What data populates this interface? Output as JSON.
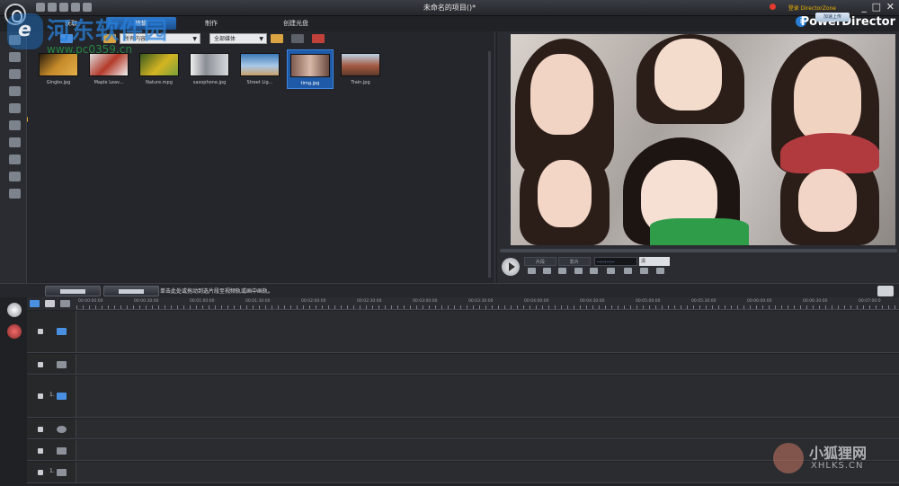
{
  "window": {
    "title": "未命名的项目()*",
    "login_text": "登录 DirectorZone",
    "upload_label": "加速上传",
    "brand": "PowerDirector",
    "controls": [
      "_",
      "□",
      "✕"
    ]
  },
  "watermark": {
    "site_title": "河东软件园",
    "site_url": "www.pc0359.cn",
    "corner_title": "小狐狸网",
    "corner_sub": "XHLKS.CN"
  },
  "mode_tabs": [
    {
      "label": "获取",
      "active": false
    },
    {
      "label": "编辑",
      "active": true
    },
    {
      "label": "制作",
      "active": false
    },
    {
      "label": "创建光盘",
      "active": false
    }
  ],
  "library": {
    "filter_dropdown": "所有内容",
    "scope_dropdown": "全部媒体",
    "items": [
      {
        "name": "Gingko.jpg",
        "color": "#c58a2a"
      },
      {
        "name": "Maple Leav...",
        "color": "#b33a2a"
      },
      {
        "name": "Nature.mpg",
        "color": "#d4b522"
      },
      {
        "name": "saxophone.jpg",
        "color": "#8a8f96"
      },
      {
        "name": "Street Lig...",
        "color": "#3c79b8"
      },
      {
        "name": "timg.jpg",
        "color": "#9c7d74",
        "selected": true
      },
      {
        "name": "Train.jpg",
        "color": "#a45a43"
      }
    ]
  },
  "preview": {
    "tabs": [
      "片段",
      "影片"
    ],
    "timecode": "--:--:--:--",
    "quality_dropdown": "清"
  },
  "timeline": {
    "hint": "单击此处或拖动到选片段至视频轨或画中画轨。",
    "ruler_labels": [
      "00:00:00:00",
      "00:00:30:00",
      "00:01:00:00",
      "00:01:30:00",
      "00:02:00:00",
      "00:02:30:00",
      "00:03:00:00",
      "00:03:30:00",
      "00:04:00:00",
      "00:04:30:00",
      "00:05:00:00",
      "00:05:30:00",
      "00:06:00:00",
      "00:06:30:00",
      "00:07:00:0"
    ],
    "tracks": [
      {
        "name": "video-track",
        "label": "",
        "icon_color": "#4a90e2"
      },
      {
        "name": "effect-track",
        "label": "",
        "icon_color": "#8d929a"
      },
      {
        "name": "pip-track",
        "label": "1.",
        "icon_color": "#4a90e2"
      },
      {
        "name": "title-track",
        "label": "",
        "icon_color": "#8d929a"
      },
      {
        "name": "voice-track",
        "label": "",
        "icon_color": "#8d929a"
      },
      {
        "name": "music-track",
        "label": "1.",
        "icon_color": "#8d929a"
      }
    ]
  }
}
